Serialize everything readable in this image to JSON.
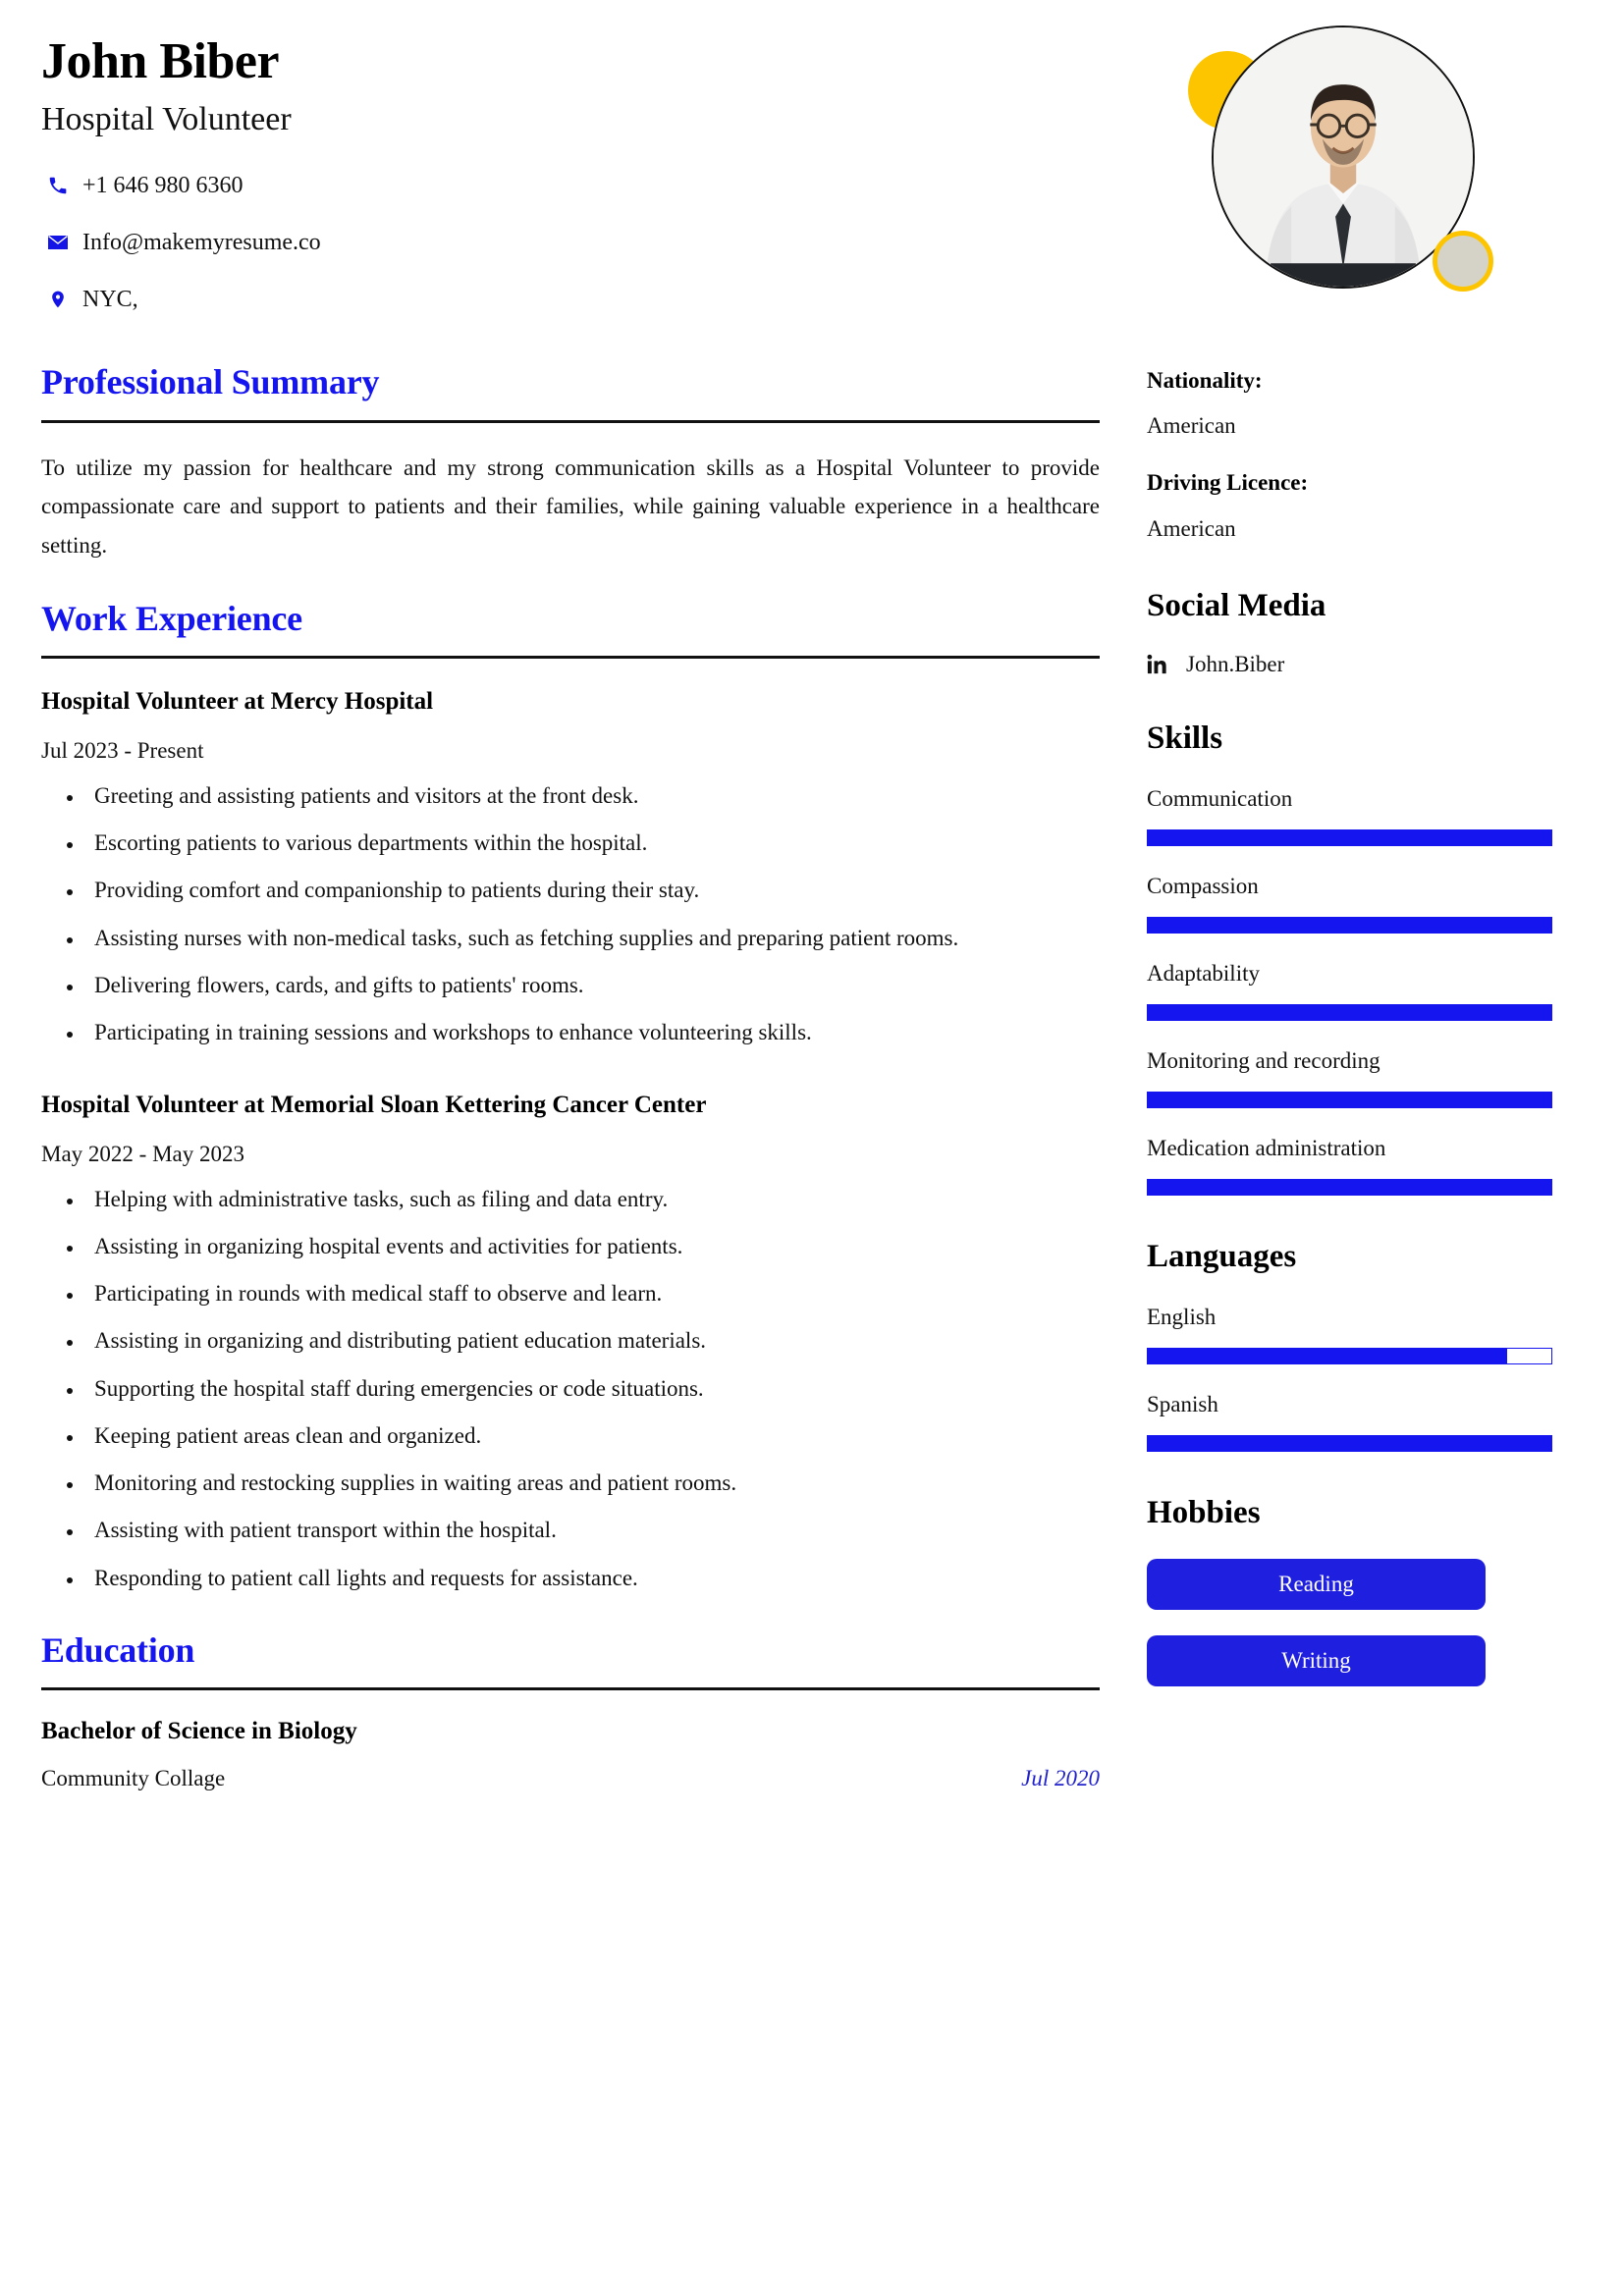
{
  "header": {
    "name": "John Biber",
    "job_title": "Hospital Volunteer",
    "contacts": [
      {
        "icon": "phone-icon",
        "value": "+1 646 980 6360"
      },
      {
        "icon": "envelope-icon",
        "value": "Info@makemyresume.co"
      },
      {
        "icon": "map-pin-icon",
        "value": "NYC,"
      }
    ]
  },
  "sections": {
    "summary_title": "Professional Summary",
    "summary_text": "To utilize my passion for healthcare and my strong communication skills as a Hospital Volunteer to provide compassionate care and support to patients and their families, while gaining valuable experience in a healthcare setting.",
    "work_title": "Work Experience",
    "education_title": "Education"
  },
  "work": [
    {
      "heading": "Hospital Volunteer at Mercy Hospital",
      "dates": "Jul 2023 - Present",
      "bullets": [
        "Greeting and assisting patients and visitors at the front desk.",
        "Escorting patients to various departments within the hospital.",
        "Providing comfort and companionship to patients during their stay.",
        "Assisting nurses with non-medical tasks, such as fetching supplies and preparing patient rooms.",
        "Delivering flowers, cards, and gifts to patients' rooms.",
        "Participating in training sessions and workshops to enhance volunteering skills."
      ]
    },
    {
      "heading": "Hospital Volunteer at Memorial Sloan Kettering Cancer Center",
      "dates": "May 2022 - May 2023",
      "bullets": [
        "Helping with administrative tasks, such as filing and data entry.",
        "Assisting in organizing hospital events and activities for patients.",
        "Participating in rounds with medical staff to observe and learn.",
        "Assisting in organizing and distributing patient education materials.",
        "Supporting the hospital staff during emergencies or code situations.",
        "Keeping patient areas clean and organized.",
        "Monitoring and restocking supplies in waiting areas and patient rooms.",
        "Assisting with patient transport within the hospital.",
        "Responding to patient call lights and requests for assistance."
      ]
    }
  ],
  "education": [
    {
      "degree": "Bachelor of Science in Biology",
      "school": "Community Collage",
      "date": "Jul 2020"
    }
  ],
  "sidebar": {
    "nationality_label": "Nationality:",
    "nationality_value": "American",
    "licence_label": "Driving Licence:",
    "licence_value": "American",
    "social_title": "Social Media",
    "social": [
      {
        "icon": "linkedin-icon",
        "name": "John.Biber"
      }
    ],
    "skills_title": "Skills",
    "skills": [
      {
        "label": "Communication",
        "level": 100
      },
      {
        "label": "Compassion",
        "level": 100
      },
      {
        "label": "Adaptability",
        "level": 100
      },
      {
        "label": "Monitoring and recording",
        "level": 100
      },
      {
        "label": "Medication administration",
        "level": 100
      }
    ],
    "languages_title": "Languages",
    "languages": [
      {
        "label": "English",
        "level": 89
      },
      {
        "label": "Spanish",
        "level": 100
      }
    ],
    "hobbies_title": "Hobbies",
    "hobbies": [
      {
        "label": "Reading"
      },
      {
        "label": "Writing"
      }
    ]
  },
  "colors": {
    "accent_blue": "#1515ef",
    "chip_blue": "#1f1fe0",
    "decor_yellow": "#fdc500",
    "decor_gray": "#d5d3c7"
  }
}
